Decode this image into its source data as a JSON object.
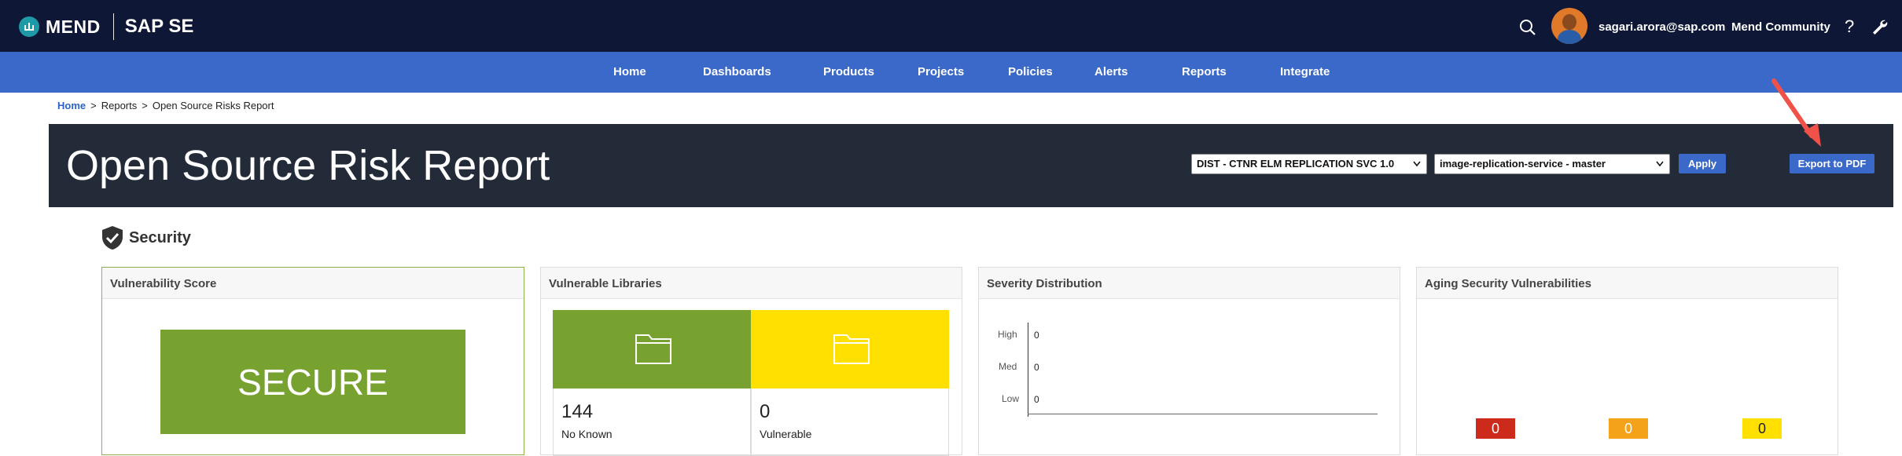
{
  "app": {
    "logo_text": "MEND",
    "org_name": "SAP SE",
    "user_email": "sagari.arora@sap.com",
    "community_label": "Mend Community",
    "help_label": "?"
  },
  "nav": {
    "items": [
      "Home",
      "Dashboards",
      "Products",
      "Projects",
      "Policies",
      "Alerts",
      "Reports",
      "Integrate"
    ]
  },
  "breadcrumb": {
    "home": "Home",
    "reports": "Reports",
    "current": "Open Source Risks Report",
    "separator": ">"
  },
  "header": {
    "title": "Open Source Risk Report",
    "product_select": "DIST - CTNR ELM REPLICATION SVC 1.0",
    "project_select": "image-replication-service - master",
    "apply_label": "Apply",
    "export_label": "Export to PDF"
  },
  "security": {
    "section_title": "Security",
    "vulnerability_score": {
      "title": "Vulnerability Score",
      "status": "SECURE",
      "status_color": "#78a22f"
    },
    "vulnerable_libraries": {
      "title": "Vulnerable Libraries",
      "no_known_count": "144",
      "no_known_label": "No Known",
      "vulnerable_count": "0",
      "vulnerable_label": "Vulnerable"
    },
    "severity_distribution": {
      "title": "Severity Distribution",
      "rows": [
        {
          "label": "High",
          "value": "0"
        },
        {
          "label": "Med",
          "value": "0"
        },
        {
          "label": "Low",
          "value": "0"
        }
      ]
    },
    "aging": {
      "title": "Aging Security Vulnerabilities",
      "boxes": [
        {
          "value": "0",
          "color": "#cc2a1a"
        },
        {
          "value": "0",
          "color": "#f5a21b"
        },
        {
          "value": "0",
          "color": "#ffe000"
        }
      ]
    }
  },
  "colors": {
    "topbar": "#0e1735",
    "nav": "#3b69c9",
    "hero": "#232a38",
    "annotation_arrow": "#f0524a"
  }
}
